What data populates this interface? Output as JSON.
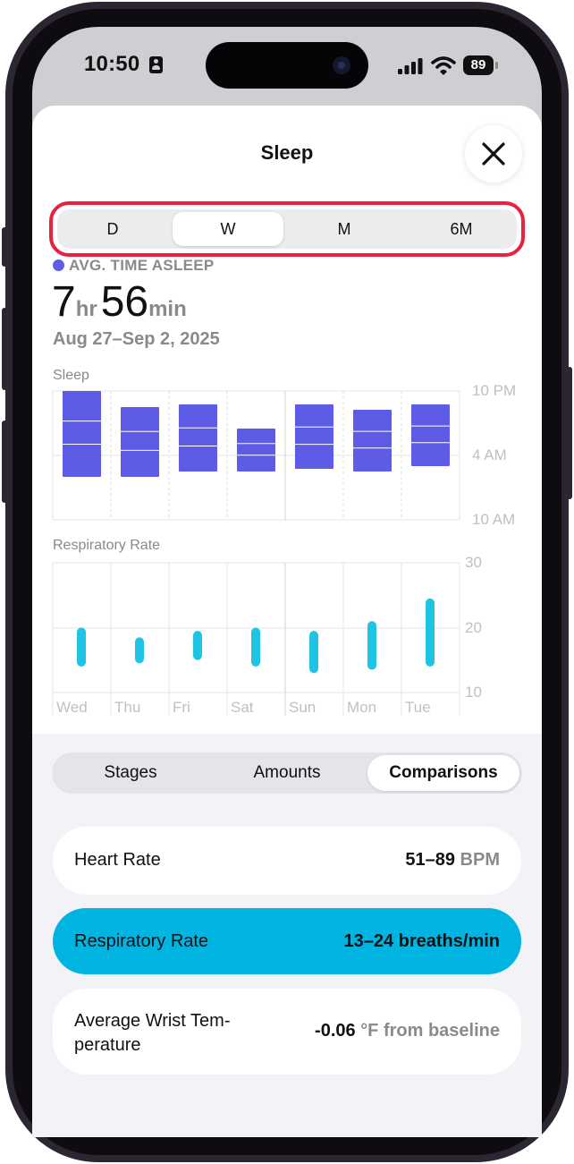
{
  "status_bar": {
    "time": "10:50",
    "battery": "89"
  },
  "sheet": {
    "title": "Sleep"
  },
  "range_selector": {
    "options": [
      "D",
      "W",
      "M",
      "6M"
    ],
    "selected": "W"
  },
  "summary": {
    "legend_label": "AVG. TIME ASLEEP",
    "hours": "7",
    "hours_unit": "hr",
    "minutes": "56",
    "minutes_unit": "min",
    "date_range": "Aug 27–Sep 2, 2025"
  },
  "charts": {
    "days": [
      "Wed",
      "Thu",
      "Fri",
      "Sat",
      "Sun",
      "Mon",
      "Tue"
    ],
    "sleep": {
      "label": "Sleep",
      "y_ticks": [
        "10 PM",
        "4 AM",
        "10 AM"
      ]
    },
    "respiratory": {
      "label": "Respiratory Rate",
      "y_ticks": [
        "30",
        "20",
        "10"
      ]
    }
  },
  "chart_data": [
    {
      "type": "bar",
      "title": "Sleep",
      "categories": [
        "Wed",
        "Thu",
        "Fri",
        "Sat",
        "Sun",
        "Mon",
        "Tue"
      ],
      "y_axis": [
        "10 PM",
        "4 AM",
        "10 AM"
      ],
      "series": [
        {
          "values": [
            {
              "start": "10:00 PM",
              "end": "6:00 AM"
            },
            {
              "start": "11:30 PM",
              "end": "6:00 AM"
            },
            {
              "start": "11:15 PM",
              "end": "5:30 AM"
            },
            {
              "start": "1:30 AM",
              "end": "5:30 AM"
            },
            {
              "start": "11:15 PM",
              "end": "5:15 AM"
            },
            {
              "start": "11:45 PM",
              "end": "5:30 AM"
            },
            {
              "start": "11:15 PM",
              "end": "5:00 AM"
            }
          ]
        }
      ],
      "color": "#5e5ce6"
    },
    {
      "type": "bar",
      "title": "Respiratory Rate",
      "categories": [
        "Wed",
        "Thu",
        "Fri",
        "Sat",
        "Sun",
        "Mon",
        "Tue"
      ],
      "ylim": [
        10,
        30
      ],
      "y_ticks": [
        10,
        20,
        30
      ],
      "series": [
        {
          "values": [
            [
              14,
              20
            ],
            [
              14.5,
              18.5
            ],
            [
              15,
              19.5
            ],
            [
              14,
              20
            ],
            [
              13,
              19.5
            ],
            [
              13.5,
              21
            ],
            [
              14,
              24.5
            ]
          ]
        }
      ],
      "color": "#1ec3e6"
    }
  ],
  "segment_tabs": {
    "items": [
      "Stages",
      "Amounts",
      "Comparisons"
    ],
    "selected": "Comparisons"
  },
  "cards": [
    {
      "label": "Heart Rate",
      "value": "51–89",
      "unit": "BPM"
    },
    {
      "label": "Respiratory Rate",
      "value": "13–24 breaths/min",
      "unit": ""
    },
    {
      "label": "Average Wrist Tem-\nperature",
      "value": "-0.06",
      "unit": "°F from baseline"
    }
  ],
  "colors": {
    "accent": "#5e5ce6",
    "highlight": "#00b4e1",
    "outline": "#e8213c"
  }
}
